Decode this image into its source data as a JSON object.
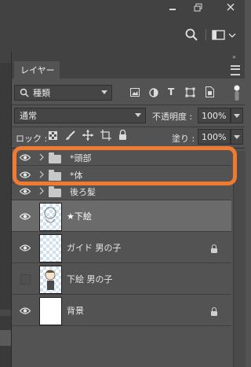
{
  "window": {
    "controls": [
      "minimize-icon",
      "restore-icon",
      "close-icon"
    ]
  },
  "toolbar": {
    "icons": [
      "search-icon",
      "workspace-icon"
    ]
  },
  "layers_panel": {
    "tab_label": "レイヤー",
    "filter": {
      "kind_label": "種類",
      "filter_icons": [
        "image-filter-icon",
        "adjustment-filter-icon",
        "type-filter-icon",
        "shape-filter-icon",
        "smartobject-filter-icon"
      ]
    },
    "blend_mode": "通常",
    "opacity_label": "不透明度 :",
    "opacity_value": "100%",
    "lock_label": "ロック :",
    "fill_label": "塗り :",
    "fill_value": "100%",
    "layers": [
      {
        "name": "*頭部",
        "type": "group",
        "visible": true
      },
      {
        "name": "*体",
        "type": "group",
        "visible": true
      },
      {
        "name": "後ろ髪",
        "type": "group",
        "visible": true
      },
      {
        "name": "★下絵",
        "type": "layer",
        "visible": true,
        "selected": true
      },
      {
        "name": "ガイド 男の子",
        "type": "layer",
        "visible": true,
        "locked": true
      },
      {
        "name": "下絵 男の子",
        "type": "layer",
        "visible": false
      },
      {
        "name": "背景",
        "type": "layer",
        "visible": true,
        "locked": true
      }
    ]
  },
  "annotation": {
    "color": "#f07a30"
  }
}
